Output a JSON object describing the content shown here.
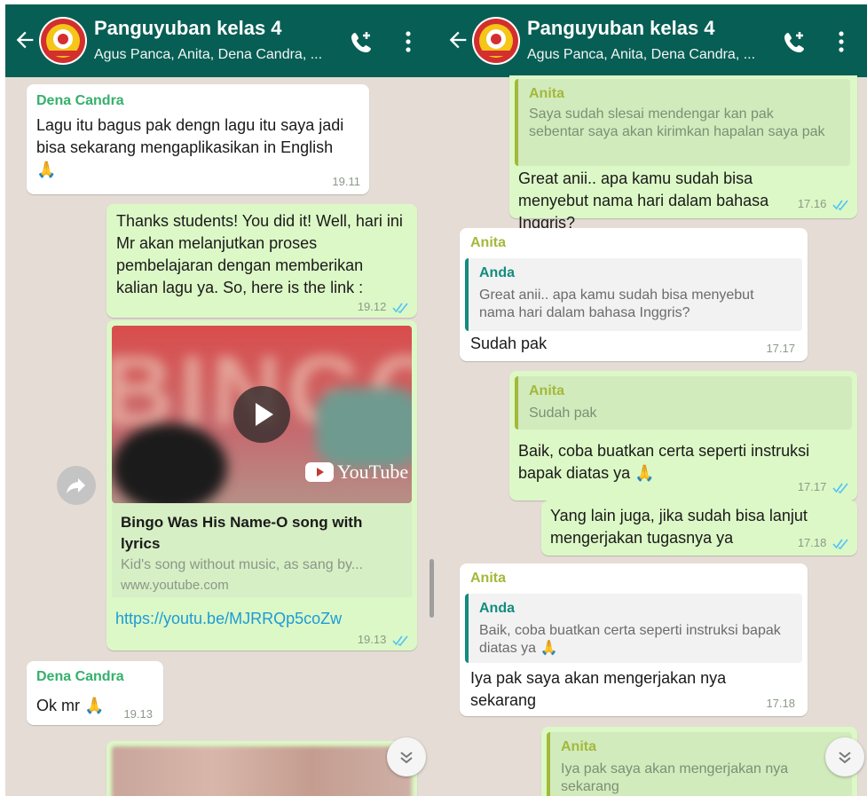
{
  "header": {
    "title": "Panguyuban kelas 4",
    "subtitle": "Agus Panca, Anita, Dena Candra, ..."
  },
  "left": {
    "msg1": {
      "sender": "Dena Candra",
      "text": "Lagu itu bagus pak dengn lagu itu saya jadi bisa sekarang mengaplikasikan in English",
      "emoji": "🙏",
      "time": "19.11"
    },
    "msg2": {
      "text": "Thanks students! You did it! Well, hari ini Mr akan melanjutkan proses pembelajaran dengan memberikan kalian lagu ya. So, here is the link :",
      "time": "19.12"
    },
    "msg3": {
      "video_logo": "YouTube",
      "preview_title": "Bingo Was His Name-O song with lyrics",
      "preview_desc": "Kid's song without music, as sang by...",
      "preview_domain": "www.youtube.com",
      "link": "https://youtu.be/MJRRQp5coZw",
      "time": "19.13"
    },
    "msg4": {
      "sender": "Dena Candra",
      "text": "Ok mr",
      "emoji": "🙏",
      "time": "19.13"
    }
  },
  "right": {
    "r1": {
      "quote_name": "Anita",
      "quote_text": "Saya sudah slesai mendengar kan pak sebentar saya akan kirimkan hapalan saya pak",
      "text": "Great anii.. apa kamu sudah bisa menyebut nama hari dalam bahasa Inggris?",
      "time": "17.16"
    },
    "r2": {
      "sender": "Anita",
      "quote_name": "Anda",
      "quote_text": "Great anii.. apa kamu sudah bisa menyebut nama hari dalam bahasa Inggris?",
      "text": "Sudah pak",
      "time": "17.17"
    },
    "r3": {
      "quote_name": "Anita",
      "quote_text": "Sudah pak",
      "text": "Baik, coba buatkan certa seperti instruksi bapak diatas ya",
      "emoji": "🙏",
      "time": "17.17"
    },
    "r4": {
      "text": "Yang lain juga, jika sudah bisa lanjut mengerjakan tugasnya ya",
      "time": "17.18"
    },
    "r5": {
      "sender": "Anita",
      "quote_name": "Anda",
      "quote_text": "Baik, coba buatkan certa seperti instruksi bapak diatas ya",
      "quote_emoji": "🙏",
      "text": "Iya pak saya akan mengerjakan nya sekarang",
      "time": "17.18"
    },
    "r6": {
      "quote_name": "Anita",
      "quote_text": "Iya pak saya akan mengerjakan nya sekarang"
    }
  },
  "icons": {
    "back": "arrow-left-icon",
    "call": "add-call-icon",
    "menu": "more-vert-icon",
    "play": "play-icon",
    "forward": "forward-icon",
    "ticks": "double-check-icon",
    "scroll": "chevron-double-down-icon"
  },
  "colors": {
    "header": "#075e54",
    "background": "#e5ddd5",
    "outgoing": "#dcf8c6",
    "incoming": "#ffffff",
    "read_ticks": "#4fc3f7",
    "link": "#1d9bd7"
  }
}
